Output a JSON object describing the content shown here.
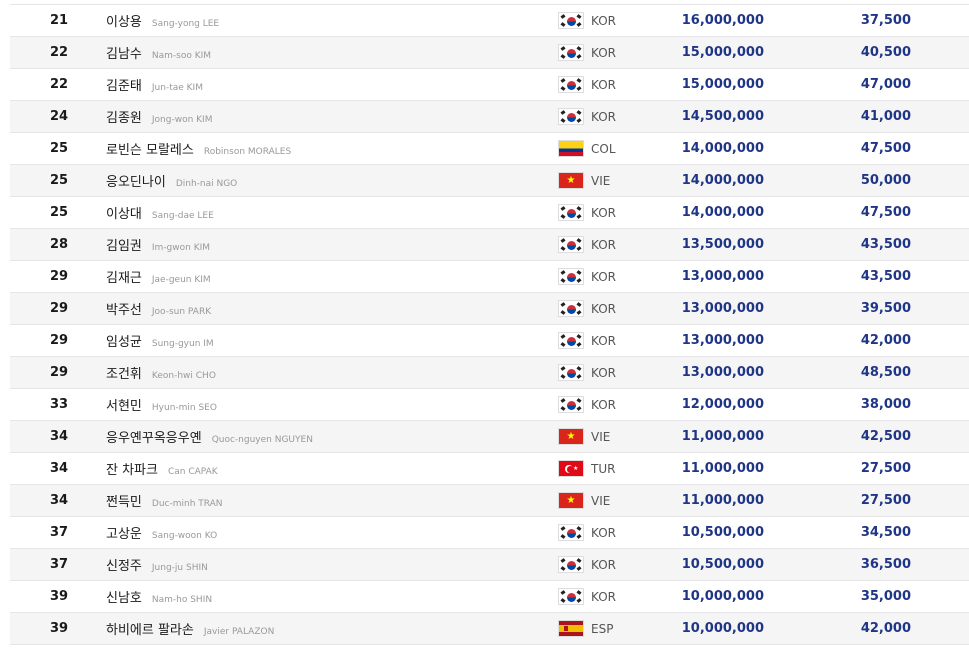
{
  "rows": [
    {
      "rank": "21",
      "kname": "이상용",
      "ename": "Sang-yong LEE",
      "flag": "KOR",
      "code": "KOR",
      "prize": "16,000,000",
      "points": "37,500"
    },
    {
      "rank": "22",
      "kname": "김남수",
      "ename": "Nam-soo KIM",
      "flag": "KOR",
      "code": "KOR",
      "prize": "15,000,000",
      "points": "40,500"
    },
    {
      "rank": "22",
      "kname": "김준태",
      "ename": "Jun-tae KIM",
      "flag": "KOR",
      "code": "KOR",
      "prize": "15,000,000",
      "points": "47,000"
    },
    {
      "rank": "24",
      "kname": "김종원",
      "ename": "Jong-won KIM",
      "flag": "KOR",
      "code": "KOR",
      "prize": "14,500,000",
      "points": "41,000"
    },
    {
      "rank": "25",
      "kname": "로빈슨 모랄레스",
      "ename": "Robinson MORALES",
      "flag": "COL",
      "code": "COL",
      "prize": "14,000,000",
      "points": "47,500"
    },
    {
      "rank": "25",
      "kname": "응오딘나이",
      "ename": "Dinh-nai NGO",
      "flag": "VIE",
      "code": "VIE",
      "prize": "14,000,000",
      "points": "50,000"
    },
    {
      "rank": "25",
      "kname": "이상대",
      "ename": "Sang-dae LEE",
      "flag": "KOR",
      "code": "KOR",
      "prize": "14,000,000",
      "points": "47,500"
    },
    {
      "rank": "28",
      "kname": "김임권",
      "ename": "Im-gwon KIM",
      "flag": "KOR",
      "code": "KOR",
      "prize": "13,500,000",
      "points": "43,500"
    },
    {
      "rank": "29",
      "kname": "김재근",
      "ename": "Jae-geun KIM",
      "flag": "KOR",
      "code": "KOR",
      "prize": "13,000,000",
      "points": "43,500"
    },
    {
      "rank": "29",
      "kname": "박주선",
      "ename": "Joo-sun PARK",
      "flag": "KOR",
      "code": "KOR",
      "prize": "13,000,000",
      "points": "39,500"
    },
    {
      "rank": "29",
      "kname": "임성균",
      "ename": "Sung-gyun IM",
      "flag": "KOR",
      "code": "KOR",
      "prize": "13,000,000",
      "points": "42,000"
    },
    {
      "rank": "29",
      "kname": "조건휘",
      "ename": "Keon-hwi CHO",
      "flag": "KOR",
      "code": "KOR",
      "prize": "13,000,000",
      "points": "48,500"
    },
    {
      "rank": "33",
      "kname": "서현민",
      "ename": "Hyun-min SEO",
      "flag": "KOR",
      "code": "KOR",
      "prize": "12,000,000",
      "points": "38,000"
    },
    {
      "rank": "34",
      "kname": "응우옌꾸옥응우옌",
      "ename": "Quoc-nguyen NGUYEN",
      "flag": "VIE",
      "code": "VIE",
      "prize": "11,000,000",
      "points": "42,500"
    },
    {
      "rank": "34",
      "kname": "잔 차파크",
      "ename": "Can CAPAK",
      "flag": "TUR",
      "code": "TUR",
      "prize": "11,000,000",
      "points": "27,500"
    },
    {
      "rank": "34",
      "kname": "쩐득민",
      "ename": "Duc-minh TRAN",
      "flag": "VIE",
      "code": "VIE",
      "prize": "11,000,000",
      "points": "27,500"
    },
    {
      "rank": "37",
      "kname": "고상운",
      "ename": "Sang-woon KO",
      "flag": "KOR",
      "code": "KOR",
      "prize": "10,500,000",
      "points": "34,500"
    },
    {
      "rank": "37",
      "kname": "신정주",
      "ename": "Jung-ju SHIN",
      "flag": "KOR",
      "code": "KOR",
      "prize": "10,500,000",
      "points": "36,500"
    },
    {
      "rank": "39",
      "kname": "신남호",
      "ename": "Nam-ho SHIN",
      "flag": "KOR",
      "code": "KOR",
      "prize": "10,000,000",
      "points": "35,000"
    },
    {
      "rank": "39",
      "kname": "하비에르 팔라손",
      "ename": "Javier PALAZON",
      "flag": "ESP",
      "code": "ESP",
      "prize": "10,000,000",
      "points": "42,000"
    }
  ]
}
